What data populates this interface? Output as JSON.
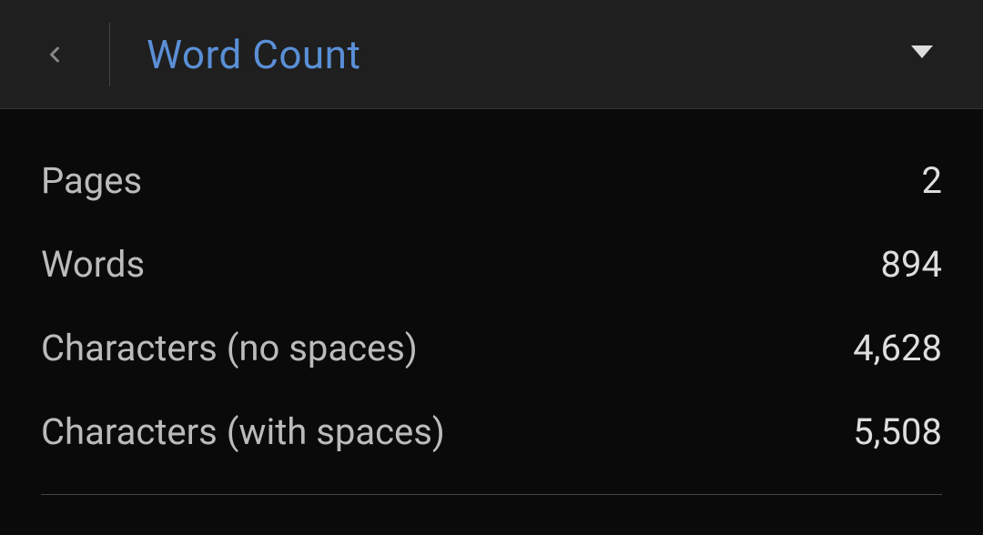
{
  "header": {
    "title": "Word Count"
  },
  "stats": {
    "pages": {
      "label": "Pages",
      "value": "2"
    },
    "words": {
      "label": "Words",
      "value": "894"
    },
    "chars_no_spaces": {
      "label": "Characters (no spaces)",
      "value": "4,628"
    },
    "chars_with_spaces": {
      "label": "Characters (with spaces)",
      "value": "5,508"
    }
  }
}
